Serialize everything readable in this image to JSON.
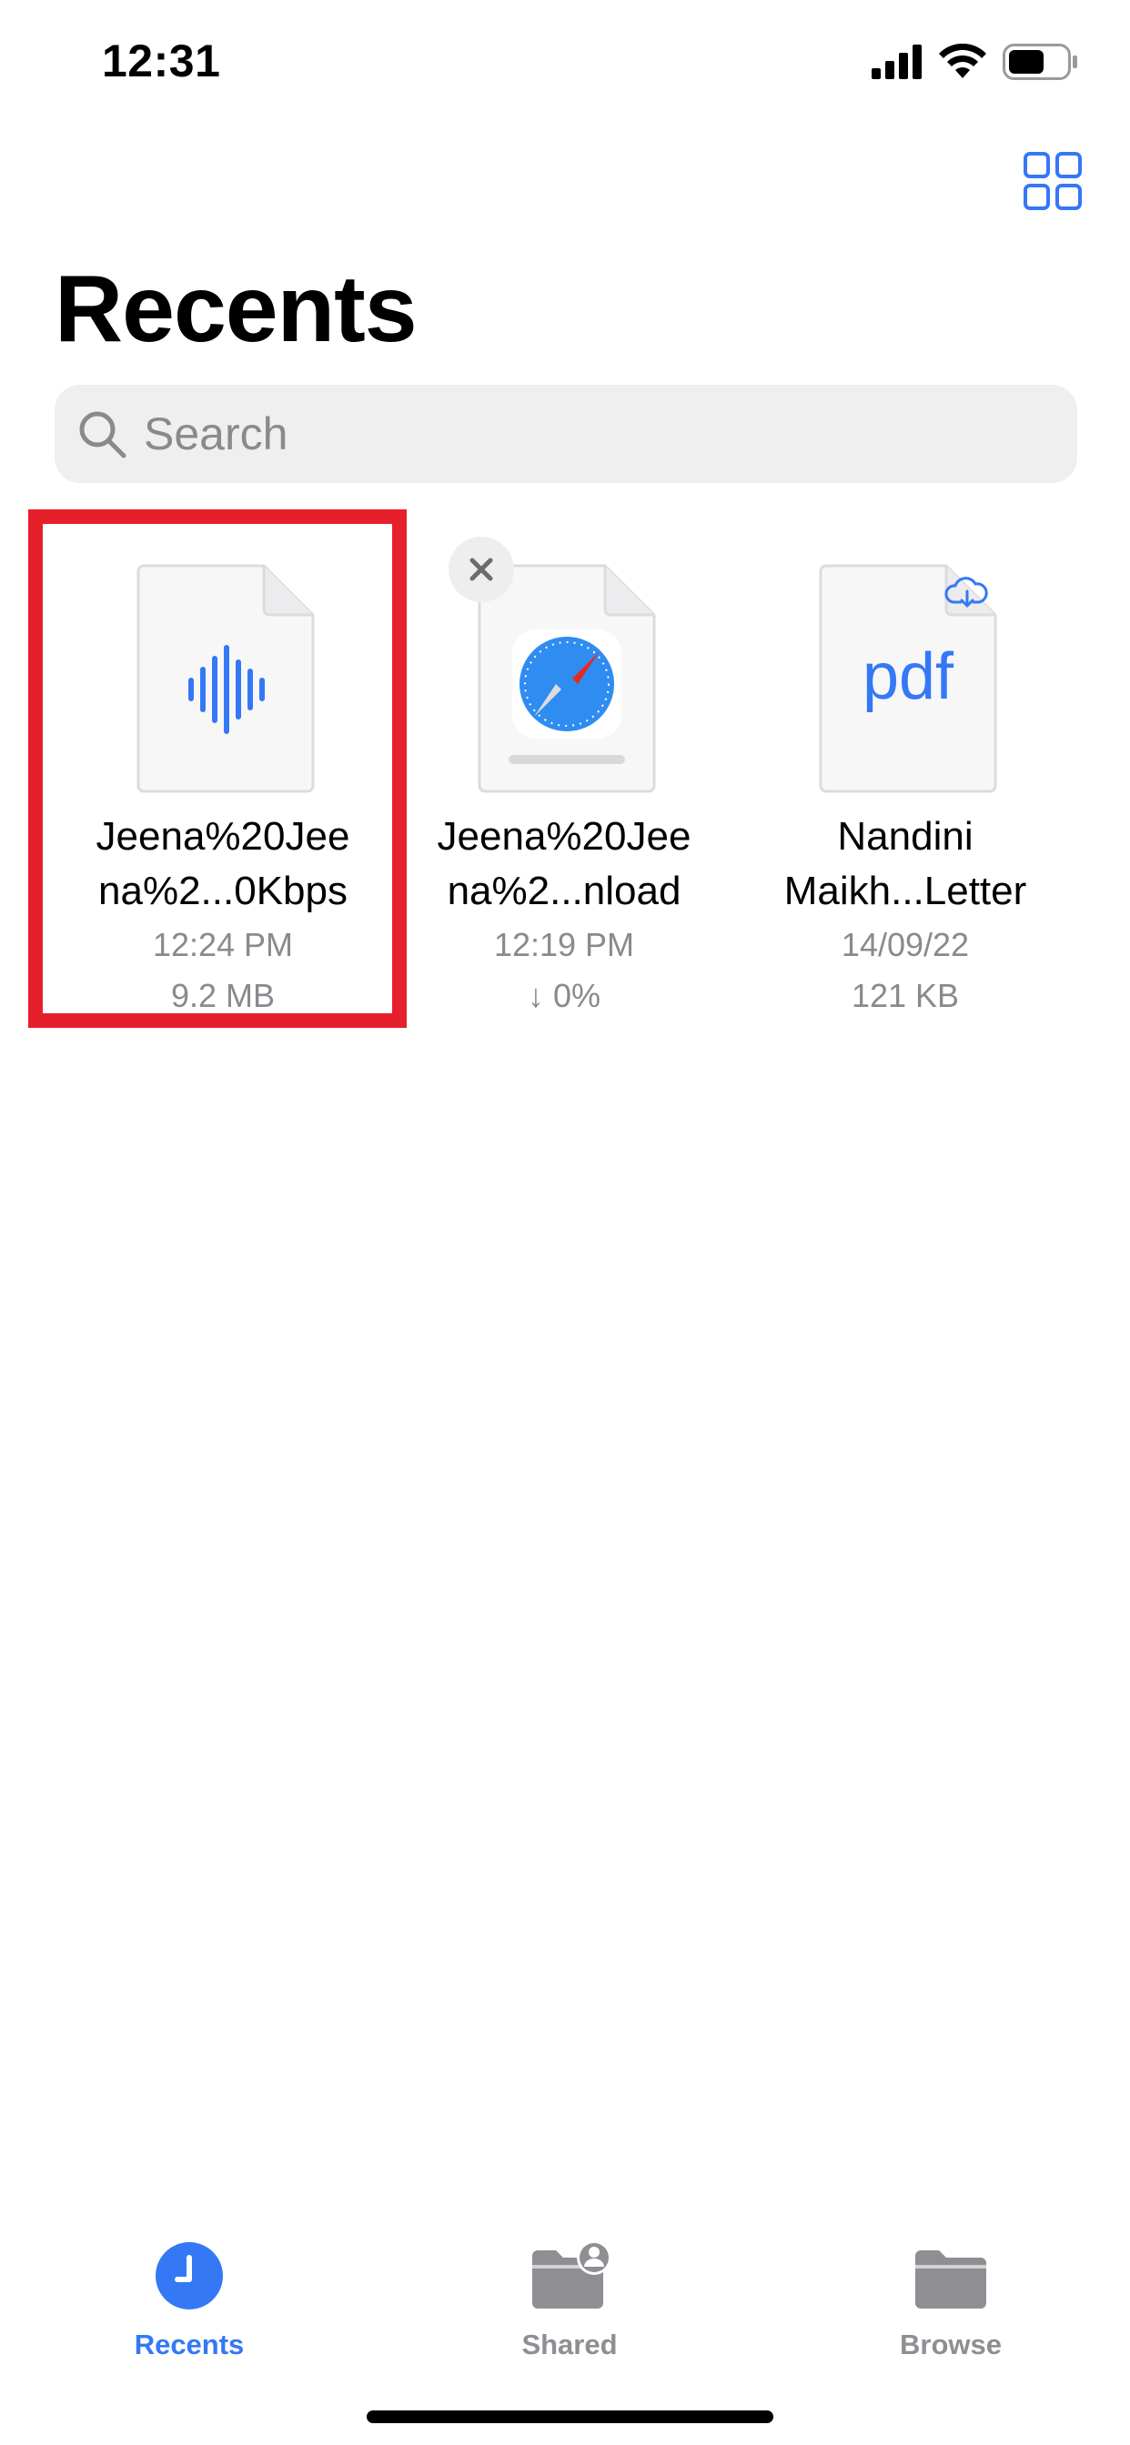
{
  "status_bar": {
    "time": "12:31"
  },
  "header": {
    "title": "Recents"
  },
  "search": {
    "placeholder": "Search",
    "value": ""
  },
  "files": [
    {
      "name_line1": "Jeena%20Jee",
      "name_line2": "na%2...0Kbps",
      "meta1": "12:24 PM",
      "meta2": "9.2 MB",
      "icon": "audio-waveform-icon"
    },
    {
      "name_line1": "Jeena%20Jee",
      "name_line2": "na%2...nload",
      "meta1": "12:19 PM",
      "meta2": "↓ 0%",
      "icon": "safari-compass-icon"
    },
    {
      "name_line1": "Nandini",
      "name_line2": "Maikh...Letter",
      "meta1": "14/09/22",
      "meta2": "121 KB",
      "icon": "pdf-document-icon",
      "thumb_text": "pdf"
    }
  ],
  "tabs": [
    {
      "label": "Recents",
      "icon": "clock-icon",
      "active": true
    },
    {
      "label": "Shared",
      "icon": "shared-folder-icon",
      "active": false
    },
    {
      "label": "Browse",
      "icon": "folder-icon",
      "active": false
    }
  ],
  "colors": {
    "accent": "#3478f6",
    "selection": "#e5202b",
    "inactive": "#8e8e93"
  }
}
